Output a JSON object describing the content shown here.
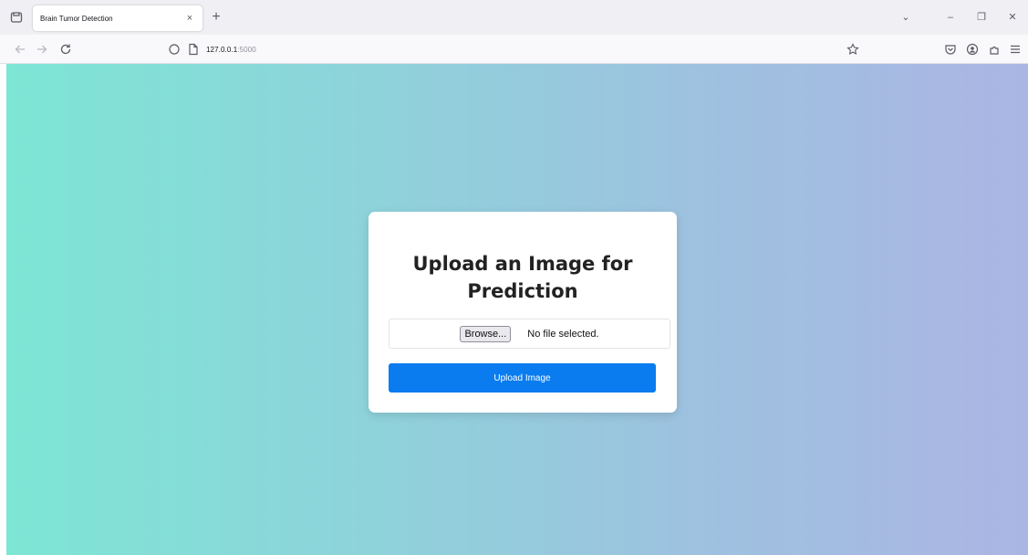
{
  "browser": {
    "tab_title": "Brain Tumor Detection",
    "tab_close": "×",
    "new_tab": "+",
    "url_host": "127.0.0.1",
    "url_port": ":5000",
    "window_controls": {
      "list_all_tabs": "⌄",
      "minimize": "–",
      "restore": "❐",
      "close": "✕"
    }
  },
  "icons": {
    "tab_overview": "firefox-view-icon",
    "back": "back-arrow-icon",
    "forward": "forward-arrow-icon",
    "reload": "reload-icon",
    "tracking": "shield-icon",
    "page": "page-icon",
    "bookmark": "star-icon",
    "pocket": "pocket-icon",
    "account": "account-icon",
    "extensions": "extensions-icon",
    "menu": "hamburger-menu-icon"
  },
  "page": {
    "title": "Upload an Image for Prediction",
    "file_input": {
      "browse_label": "Browse...",
      "status": "No file selected."
    },
    "submit_label": "Upload Image"
  },
  "colors": {
    "gradient_start": "#7de6d5",
    "gradient_end": "#abb5e3",
    "primary_button": "#0a7cf0"
  }
}
